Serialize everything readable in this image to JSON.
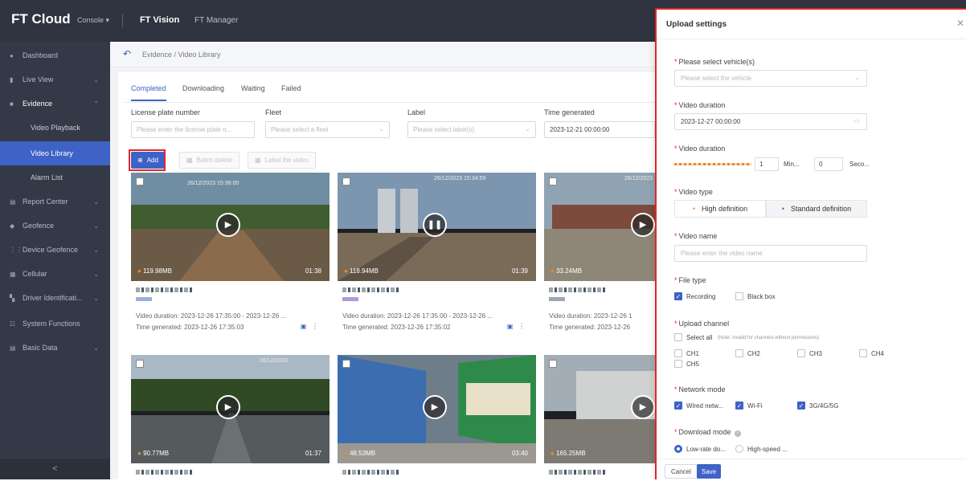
{
  "topbar": {
    "brand": "FT Cloud",
    "console": "Console ▾",
    "app_active": "FT Vision",
    "app_other": "FT Manager"
  },
  "sidebar": {
    "items": [
      {
        "label": "Dashboard",
        "icon": "dashboard-icon"
      },
      {
        "label": "Live View",
        "icon": "live-view-icon"
      },
      {
        "label": "Evidence",
        "icon": "evidence-icon"
      },
      {
        "label": "Video Playback"
      },
      {
        "label": "Video Library"
      },
      {
        "label": "Alarm List"
      },
      {
        "label": "Report Center",
        "icon": "report-icon"
      },
      {
        "label": "Geofence",
        "icon": "geofence-icon"
      },
      {
        "label": "Device Geofence",
        "icon": "device-geofence-icon"
      },
      {
        "label": "Cellular",
        "icon": "cellular-icon"
      },
      {
        "label": "Driver Identificati...",
        "icon": "driver-id-icon"
      },
      {
        "label": "System Functions",
        "icon": "system-icon"
      },
      {
        "label": "Basic Data",
        "icon": "basic-data-icon"
      }
    ],
    "collapse": "<"
  },
  "breadcrumb": {
    "text": "Evidence / Video Library"
  },
  "tabs": [
    "Completed",
    "Downloading",
    "Waiting",
    "Failed"
  ],
  "filters": {
    "plate_label": "License plate number",
    "plate_placeholder": "Please enter the license plate n...",
    "fleet_label": "Fleet",
    "fleet_placeholder": "Please select a fleet",
    "label_label": "Label",
    "label_placeholder": "Please select label(s)",
    "time_label": "Time generated",
    "time_value": "2023-12-21 00:00:00"
  },
  "actions": {
    "add": "Add",
    "batch_delete": "Batch delete",
    "label_video": "Label the video"
  },
  "videos": [
    {
      "size": "119.98MB",
      "duration": "01:38",
      "video_duration": "Video duration:  2023-12-26 17:35:00 - 2023-12-26 ...",
      "time_generated": "Time generated:  2023-12-26 17:35:03",
      "ts": "26/12/2023 15:36:00",
      "playing": false
    },
    {
      "size": "118.94MB",
      "duration": "01:39",
      "video_duration": "Video duration:  2023-12-26 17:35:00 - 2023-12-26 ...",
      "time_generated": "Time generated:  2023-12-26 17:35:02",
      "ts": "26/12/2023 15:34:59",
      "playing": true
    },
    {
      "size": "33.24MB",
      "duration": "",
      "video_duration": "Video duration:  2023-12-26 1",
      "time_generated": "Time generated:  2023-12-26",
      "ts": "26/12/2023",
      "playing": false
    },
    {
      "size": "90.77MB",
      "duration": "01:37",
      "ts": "26/12/2023",
      "playing": false
    },
    {
      "size": "48.53MB",
      "duration": "03:40",
      "ts": "",
      "playing": false
    },
    {
      "size": "165.25MB",
      "duration": "",
      "ts": "",
      "playing": false
    }
  ],
  "panel": {
    "title": "Upload settings",
    "close": "✕",
    "vehicle_label": "Please select vehicle(s)",
    "vehicle_placeholder": "Please select the vehicle",
    "duration1_label": "Video duration",
    "duration1_value": "2023-12-27 00:00:00",
    "duration2_label": "Video duration",
    "duration_min_value": "1",
    "duration_min_unit": "Min...",
    "duration_sec_value": "0",
    "duration_sec_unit": "Seco...",
    "type_label": "Video type",
    "type_hd": "High definition",
    "type_sd": "Standard definition",
    "name_label": "Video name",
    "name_placeholder": "Please enter the video name",
    "file_type_label": "File type",
    "file_recording": "Recording",
    "file_blackbox": "Black box",
    "channel_label": "Upload channel",
    "select_all": "Select all",
    "channel_note": "(Note: Invalid for channels without permissions)",
    "channels": [
      "CH1",
      "CH2",
      "CH3",
      "CH4",
      "CH5"
    ],
    "network_label": "Network mode",
    "net_wired": "Wired netw...",
    "net_wifi": "Wi-Fi",
    "net_cell": "3G/4G/5G",
    "download_label": "Download mode",
    "dl_low": "Low-rate do...",
    "dl_high": "High-speed ...",
    "cancel": "Cancel",
    "save": "Save"
  },
  "colors": {
    "accent": "#3f62c7",
    "highlight": "#e0262b",
    "sidebar": "#333947",
    "topbar": "#2f3440"
  }
}
